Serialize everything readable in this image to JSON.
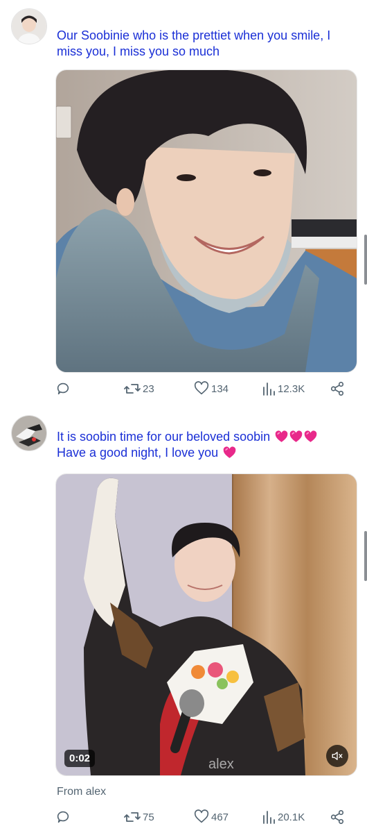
{
  "posts": [
    {
      "text": "Our Soobinie who is the prettiet when you smile, I miss you, I miss you so much",
      "stats": {
        "retweets": "23",
        "likes": "134",
        "views": "12.3K"
      }
    },
    {
      "text": "It is soobin time for our beloved soobin",
      "text_line2": "Have a good night, I love you",
      "video": {
        "time": "0:02",
        "watermark": "alex"
      },
      "source": "From alex",
      "stats": {
        "retweets": "75",
        "likes": "467",
        "views": "20.1K"
      }
    }
  ],
  "colors": {
    "tweet_text": "#1a2fd6",
    "meta_gray": "#536471",
    "heart_emoji": "#e8298a"
  },
  "icons": [
    "reply-icon",
    "retweet-icon",
    "like-icon",
    "views-icon",
    "share-icon",
    "mute-icon",
    "heart-emoji-icon"
  ]
}
